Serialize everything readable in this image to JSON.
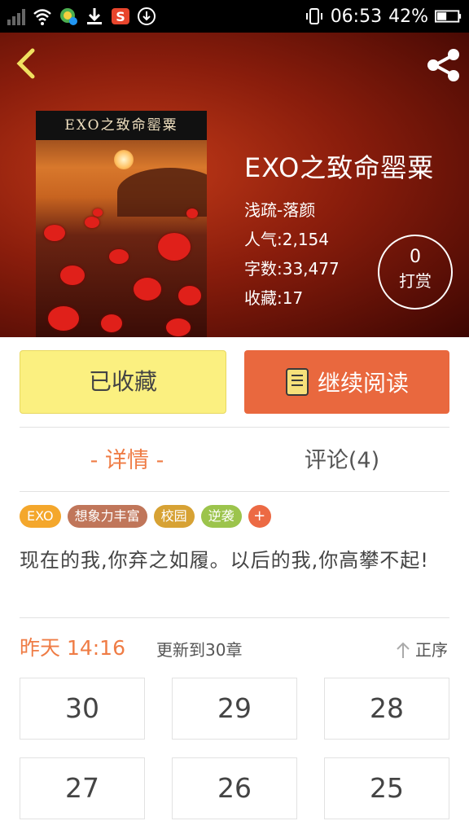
{
  "status_bar": {
    "time": "06:53",
    "battery": "42%",
    "left_icons": [
      "signal-icon",
      "wifi-icon",
      "app-notification-icon",
      "download-icon",
      "sogou-icon",
      "download-circle-icon"
    ],
    "right_icons": [
      "vibrate-icon",
      "battery-icon"
    ]
  },
  "header": {
    "back_icon": "chevron-left-icon",
    "share_icon": "share-icon",
    "accent_color": "#f0e060"
  },
  "book": {
    "cover_text": "EXO之致命罂粟",
    "title": "EXO之致命罂粟",
    "author": "浅疏-落颜",
    "popularity": "人气:2,154",
    "word_count": "字数:33,477",
    "favorites": "收藏:17"
  },
  "reward": {
    "count": "0",
    "label": "打赏"
  },
  "actions": {
    "favorited_label": "已收藏",
    "continue_label": "继续阅读",
    "continue_icon": "book-icon"
  },
  "tabs": {
    "detail": "- 详情 -",
    "comments": "评论(4)"
  },
  "tags": [
    {
      "label": "EXO",
      "color": "#f4a72c"
    },
    {
      "label": "想象力丰富",
      "color": "#c0765a"
    },
    {
      "label": "校园",
      "color": "#d7a234"
    },
    {
      "label": "逆袭",
      "color": "#9cc44c"
    }
  ],
  "tag_add": "+",
  "description": "现在的我,你弃之如履。以后的我,你高攀不起!",
  "update": {
    "time": "昨天 14:16",
    "text": "更新到30章",
    "sort_label": "正序",
    "sort_icon": "arrow-up-icon"
  },
  "chapters": [
    "30",
    "29",
    "28",
    "27",
    "26",
    "25"
  ]
}
